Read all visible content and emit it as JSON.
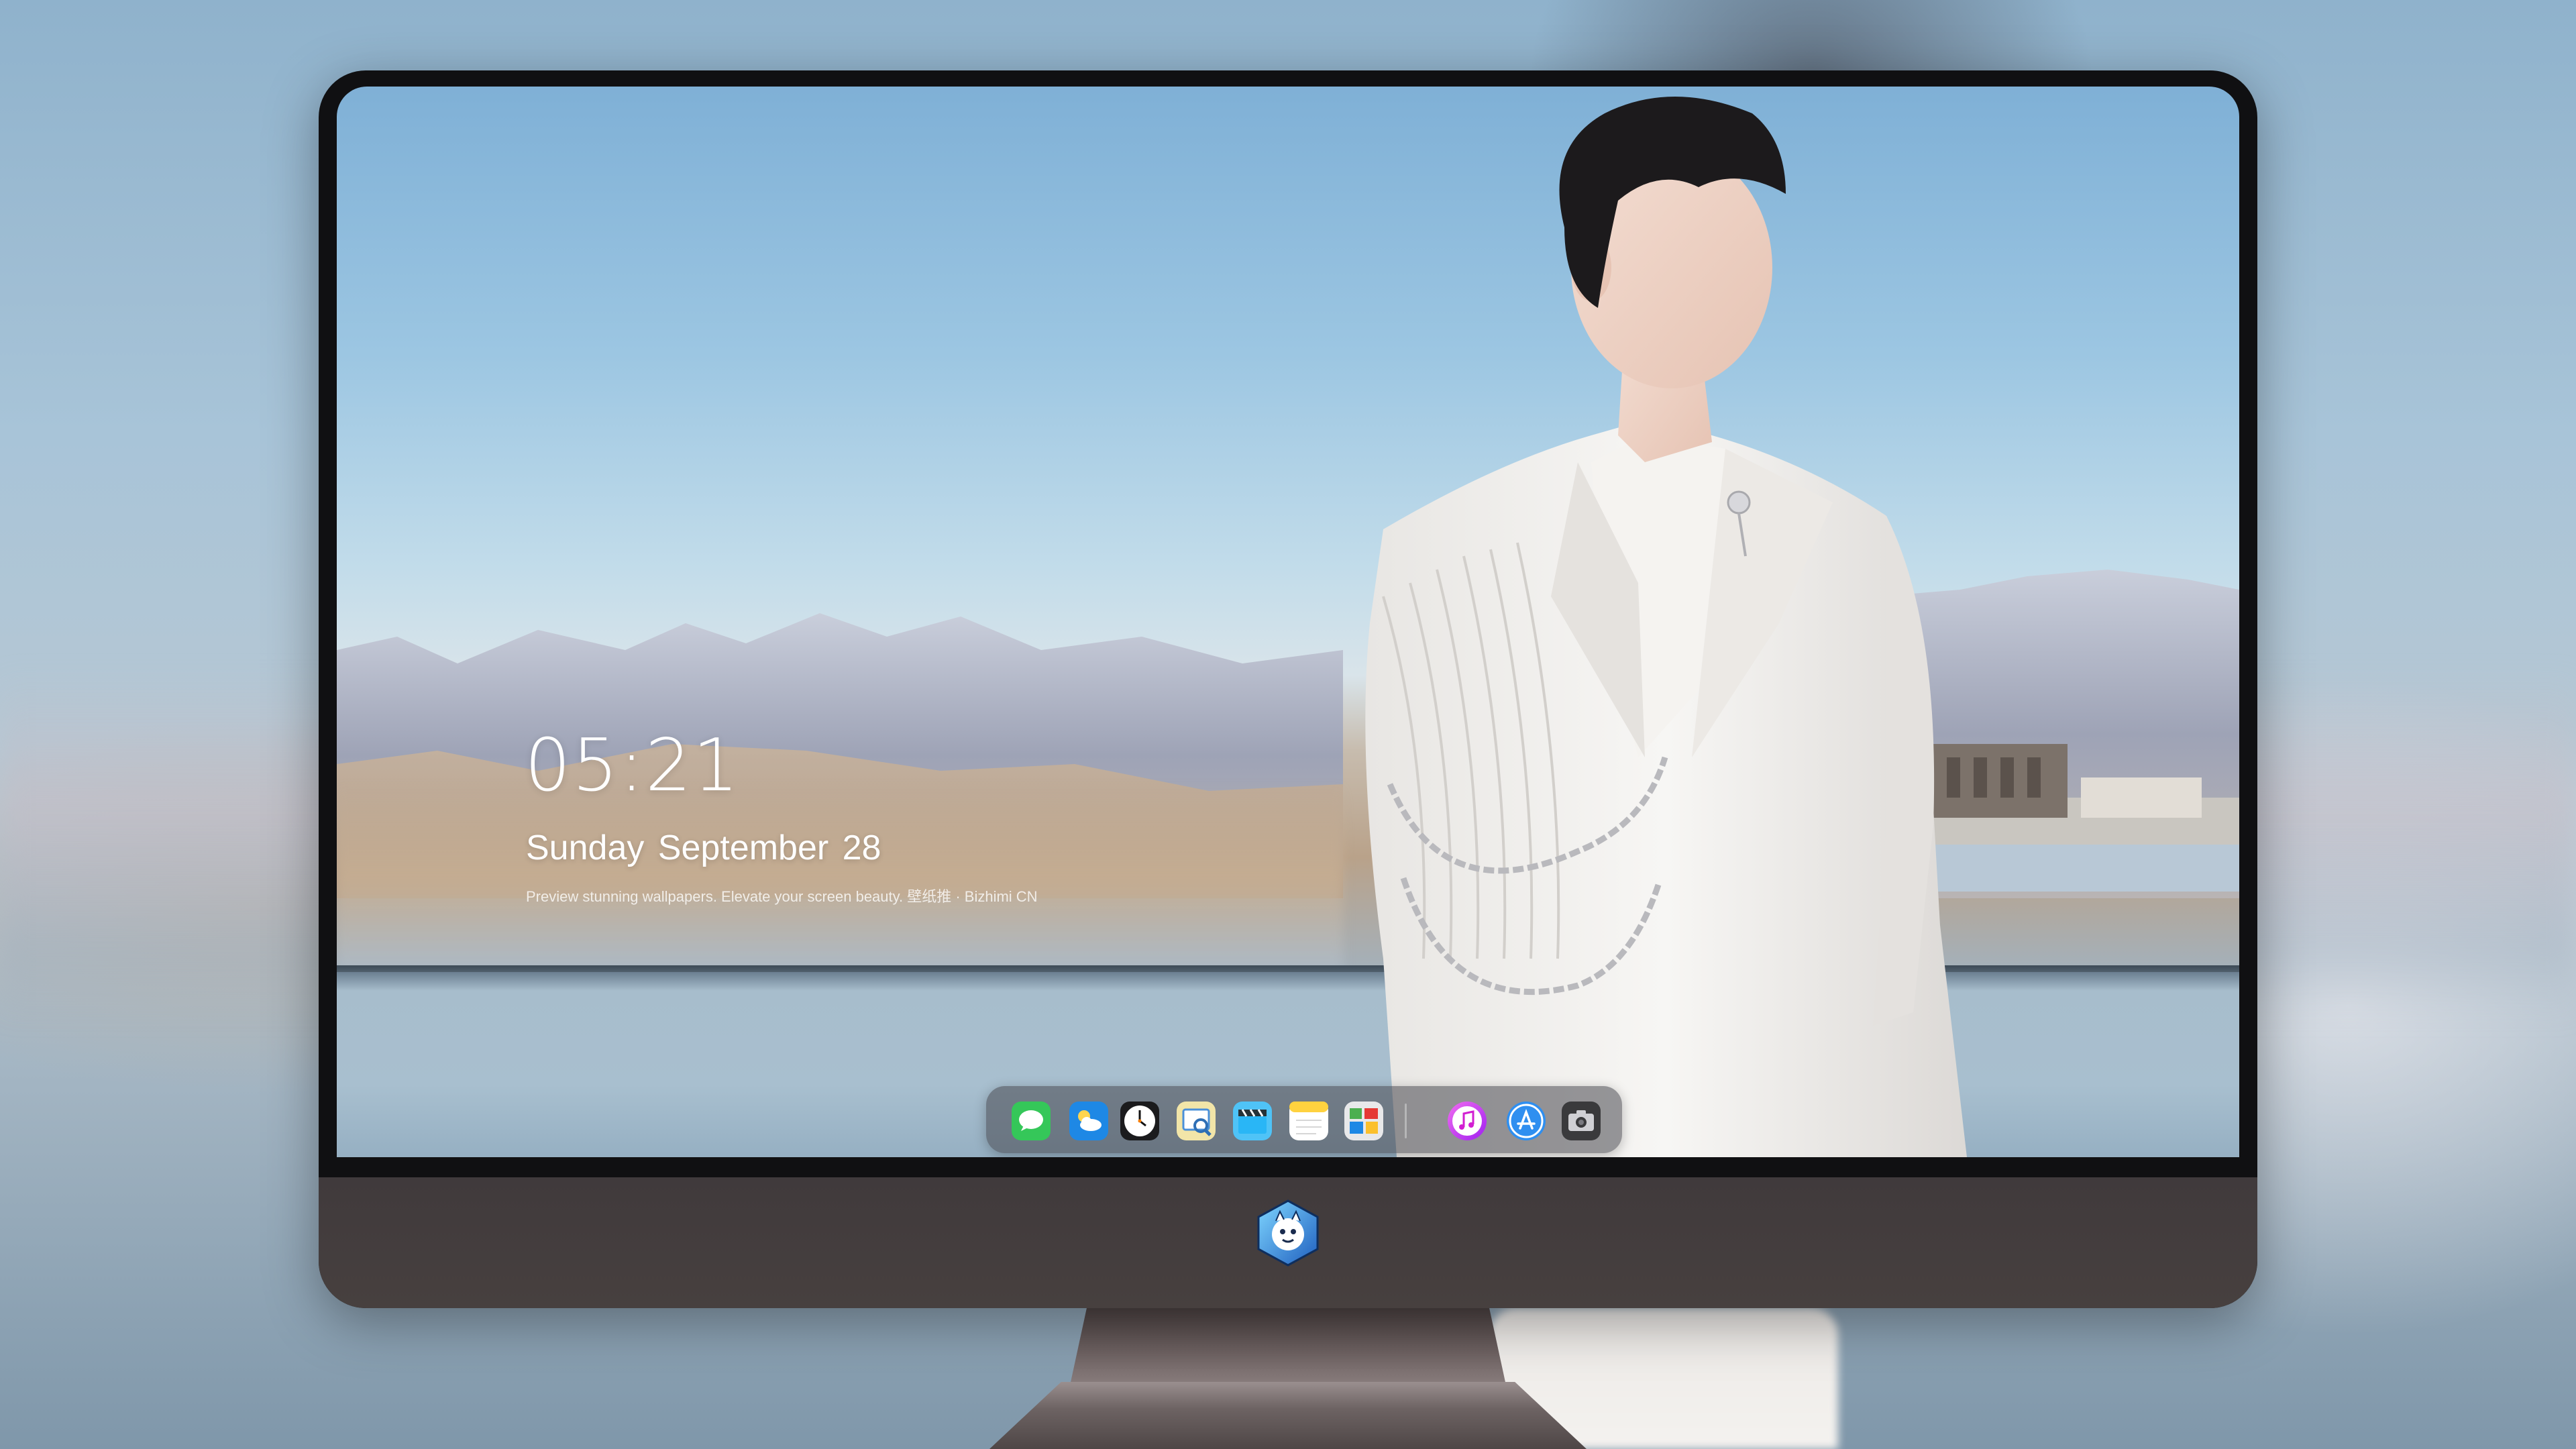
{
  "lockscreen": {
    "time": "05:21",
    "date": "Sunday September  28",
    "tagline": "Preview stunning wallpapers. Elevate your screen beauty. 壁纸推 · Bizhimi CN"
  },
  "dock": {
    "apps": [
      {
        "name": "Messages",
        "icon": "messages-icon"
      },
      {
        "name": "Weather",
        "icon": "weather-icon"
      },
      {
        "name": "Clock",
        "icon": "clock-icon"
      },
      {
        "name": "Preview",
        "icon": "preview-icon"
      },
      {
        "name": "Clips",
        "icon": "clapperboard-icon"
      },
      {
        "name": "Notes",
        "icon": "notes-icon"
      },
      {
        "name": "Photo Board",
        "icon": "photo-board-icon"
      },
      {
        "name": "iTunes",
        "icon": "music-icon"
      },
      {
        "name": "App Store",
        "icon": "app-store-icon"
      },
      {
        "name": "Camera",
        "icon": "camera-icon"
      }
    ]
  },
  "monitor": {
    "logo": "mascot-logo-icon"
  },
  "colors": {
    "bezel": "#101012",
    "chin": "#433c3d",
    "dock_bg": "#46464c"
  }
}
